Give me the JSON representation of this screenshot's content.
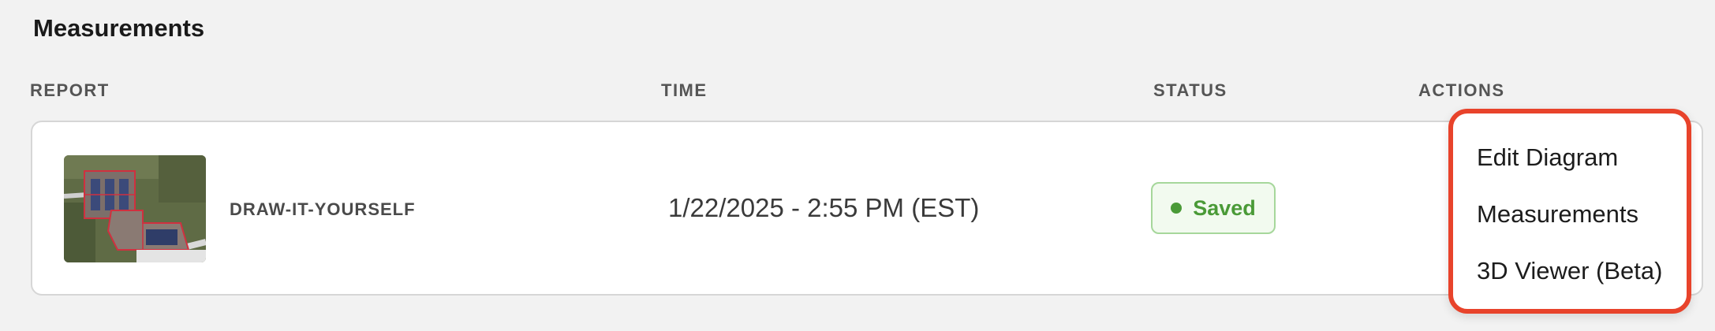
{
  "page": {
    "title": "Measurements"
  },
  "columns": {
    "report": "REPORT",
    "time": "TIME",
    "status": "STATUS",
    "actions": "ACTIONS"
  },
  "row": {
    "report_name": "DRAW-IT-YOURSELF",
    "time": "1/22/2025 - 2:55 PM (EST)",
    "status": "Saved",
    "status_color": "#4a9a37"
  },
  "actions_menu": {
    "border_color": "#e8432b",
    "items": [
      {
        "label": "Edit Diagram"
      },
      {
        "label": "Measurements"
      },
      {
        "label": "3D Viewer (Beta)"
      }
    ]
  }
}
